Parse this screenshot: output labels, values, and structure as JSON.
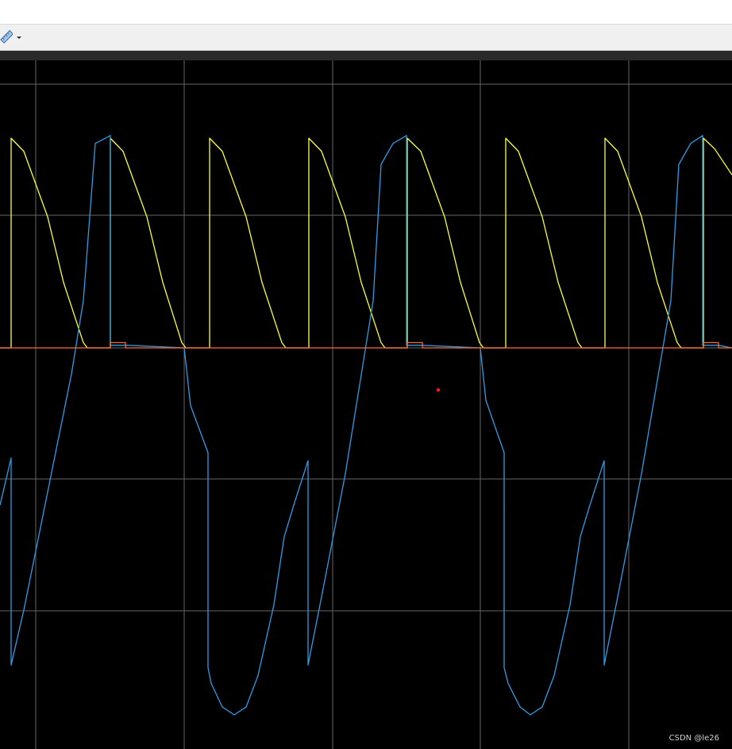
{
  "window": {
    "toolbar": {
      "ruler_tool_icon": "ruler-icon",
      "dropdown_icon": "caret-down-icon"
    }
  },
  "watermark": "CSDN @le26",
  "colors": {
    "plot_bg": "#000000",
    "grid": "#666666",
    "yellow_trace": "#ffff33",
    "blue_trace": "#2e9ce6",
    "orange_trace": "#ff6a2e",
    "cursor_marker": "#ff1a1a"
  },
  "chart_data": {
    "type": "line",
    "grid": true,
    "title": "",
    "xlabel": "",
    "ylabel": "",
    "xlim": [
      0,
      922
    ],
    "ylim": [
      -1,
      1
    ],
    "series": [
      {
        "color": "#ffff33",
        "x": [
          0,
          14,
          14,
          30,
          60,
          80,
          105,
          110,
          139,
          139,
          155,
          185,
          205,
          229,
          234,
          264,
          264,
          280,
          310,
          330,
          355,
          360,
          389,
          389,
          405,
          435,
          455,
          480,
          485,
          513,
          513,
          530,
          560,
          580,
          604,
          609,
          637,
          637,
          653,
          683,
          703,
          728,
          733,
          762,
          762,
          778,
          808,
          828,
          853,
          858,
          886,
          886,
          900,
          922
        ],
        "y": [
          0,
          0,
          0.8,
          0.75,
          0.5,
          0.25,
          0.02,
          0,
          0,
          0.8,
          0.75,
          0.5,
          0.25,
          0.02,
          0,
          0,
          0.8,
          0.75,
          0.5,
          0.25,
          0.02,
          0,
          0,
          0.8,
          0.75,
          0.5,
          0.25,
          0.02,
          0,
          0,
          0.8,
          0.75,
          0.5,
          0.25,
          0.02,
          0,
          0,
          0.8,
          0.75,
          0.5,
          0.25,
          0.02,
          0,
          0,
          0.8,
          0.75,
          0.5,
          0.25,
          0.02,
          0,
          0,
          0.8,
          0.76,
          0.66
        ]
      },
      {
        "color": "#2e9ce6",
        "x": [
          0,
          14,
          14,
          30,
          60,
          90,
          105,
          120,
          139,
          139,
          160,
          232,
          240,
          262,
          262,
          266,
          280,
          295,
          310,
          325,
          345,
          358,
          370,
          388,
          388,
          405,
          435,
          470,
          480,
          495,
          512,
          512,
          530,
          605,
          612,
          635,
          635,
          640,
          655,
          668,
          683,
          698,
          718,
          731,
          743,
          761,
          761,
          778,
          808,
          845,
          855,
          870,
          885,
          885,
          905,
          922
        ],
        "y": [
          -0.6,
          -0.42,
          -1.21,
          -1.0,
          -0.55,
          -0.1,
          0.18,
          0.78,
          0.81,
          0.01,
          0.01,
          0,
          -0.22,
          -0.4,
          -1.22,
          -1.28,
          -1.37,
          -1.4,
          -1.37,
          -1.25,
          -0.98,
          -0.72,
          -0.6,
          -0.43,
          -1.21,
          -0.95,
          -0.48,
          0.18,
          0.7,
          0.78,
          0.81,
          0.01,
          0.01,
          0,
          -0.2,
          -0.4,
          -1.22,
          -1.28,
          -1.37,
          -1.4,
          -1.37,
          -1.25,
          -0.98,
          -0.72,
          -0.6,
          -0.43,
          -1.21,
          -0.95,
          -0.48,
          0.18,
          0.7,
          0.78,
          0.81,
          0.01,
          0.01,
          0
        ]
      },
      {
        "color": "#ff6a2e",
        "x": [
          0,
          139,
          139,
          158,
          158,
          513,
          513,
          532,
          532,
          886,
          886,
          905,
          905,
          922
        ],
        "y": [
          0,
          0,
          0.02,
          0.02,
          0,
          0,
          0.02,
          0.02,
          0,
          0,
          0.02,
          0.02,
          0,
          0
        ]
      }
    ]
  }
}
